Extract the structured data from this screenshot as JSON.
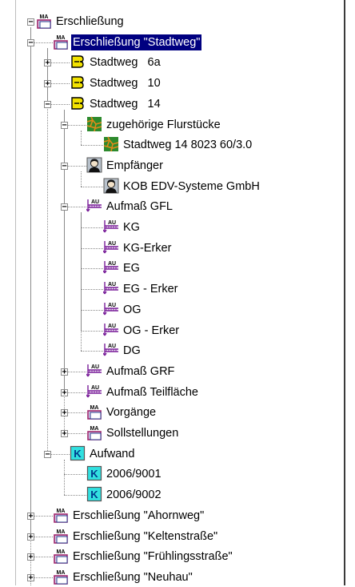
{
  "nodes": [
    {
      "depth": 0,
      "label": "Erschließung",
      "icon": "ma-folder-icon",
      "exp": "minus"
    },
    {
      "depth": 1,
      "label": "Erschließung \"Stadtweg\"",
      "icon": "ma-folder-icon",
      "exp": "minus",
      "selected": true
    },
    {
      "depth": 2,
      "label": "Stadtweg   6a",
      "icon": "street-icon",
      "exp": "plus"
    },
    {
      "depth": 2,
      "label": "Stadtweg   10",
      "icon": "street-icon",
      "exp": "plus"
    },
    {
      "depth": 2,
      "label": "Stadtweg   14",
      "icon": "street-icon",
      "exp": "minus"
    },
    {
      "depth": 3,
      "label": "zugehörige Flurstücke",
      "icon": "parcel-map-icon",
      "exp": "minus"
    },
    {
      "depth": 4,
      "label": "Stadtweg 14 8023 60/3.0",
      "icon": "parcel-map-icon",
      "exp": "none"
    },
    {
      "depth": 3,
      "label": "Empfänger",
      "icon": "person-icon",
      "exp": "minus"
    },
    {
      "depth": 4,
      "label": "KOB EDV-Systeme GmbH",
      "icon": "person-icon",
      "exp": "none"
    },
    {
      "depth": 3,
      "label": "Aufmaß GFL",
      "icon": "au-measure-icon",
      "exp": "minus"
    },
    {
      "depth": 4,
      "label": "KG",
      "icon": "au-measure-icon",
      "exp": "none"
    },
    {
      "depth": 4,
      "label": "KG-Erker",
      "icon": "au-measure-icon",
      "exp": "none"
    },
    {
      "depth": 4,
      "label": "EG",
      "icon": "au-measure-icon",
      "exp": "none"
    },
    {
      "depth": 4,
      "label": "EG - Erker",
      "icon": "au-measure-icon",
      "exp": "none"
    },
    {
      "depth": 4,
      "label": "OG",
      "icon": "au-measure-icon",
      "exp": "none"
    },
    {
      "depth": 4,
      "label": "OG - Erker",
      "icon": "au-measure-icon",
      "exp": "none"
    },
    {
      "depth": 4,
      "label": "DG",
      "icon": "au-measure-icon",
      "exp": "none"
    },
    {
      "depth": 3,
      "label": "Aufmaß GRF",
      "icon": "au-measure-icon",
      "exp": "plus"
    },
    {
      "depth": 3,
      "label": "Aufmaß Teilfläche",
      "icon": "au-measure-icon",
      "exp": "plus"
    },
    {
      "depth": 3,
      "label": "Vorgänge",
      "icon": "ma-folder-icon",
      "exp": "plus"
    },
    {
      "depth": 3,
      "label": "Sollstellungen",
      "icon": "ma-folder-icon",
      "exp": "plus"
    },
    {
      "depth": 2,
      "label": "Aufwand",
      "icon": "k-icon",
      "exp": "minus"
    },
    {
      "depth": 3,
      "label": "2006/9001",
      "icon": "k-icon",
      "exp": "none"
    },
    {
      "depth": 3,
      "label": "2006/9002",
      "icon": "k-icon",
      "exp": "none"
    },
    {
      "depth": 1,
      "label": "Erschließung \"Ahornweg\"",
      "icon": "ma-folder-icon",
      "exp": "plus"
    },
    {
      "depth": 1,
      "label": "Erschließung \"Keltenstraße\"",
      "icon": "ma-folder-icon",
      "exp": "plus"
    },
    {
      "depth": 1,
      "label": "Erschließung \"Frühlingsstraße\"",
      "icon": "ma-folder-icon",
      "exp": "plus"
    },
    {
      "depth": 1,
      "label": "Erschließung \"Neuhau\"",
      "icon": "ma-folder-icon",
      "exp": "plus"
    }
  ],
  "icon_text": {
    "ma": "MA",
    "au": "AU",
    "k": "K"
  },
  "colors": {
    "selection_bg": "#000080",
    "ma_pink": "#a0266e",
    "ma_blue": "#2b3f8f",
    "street_yellow": "#f2e200",
    "parcel_green": "#2d8a2d",
    "parcel_orange": "#e08a1a",
    "k_cyan": "#31e0e0",
    "au_purple": "#7a1f9a"
  }
}
